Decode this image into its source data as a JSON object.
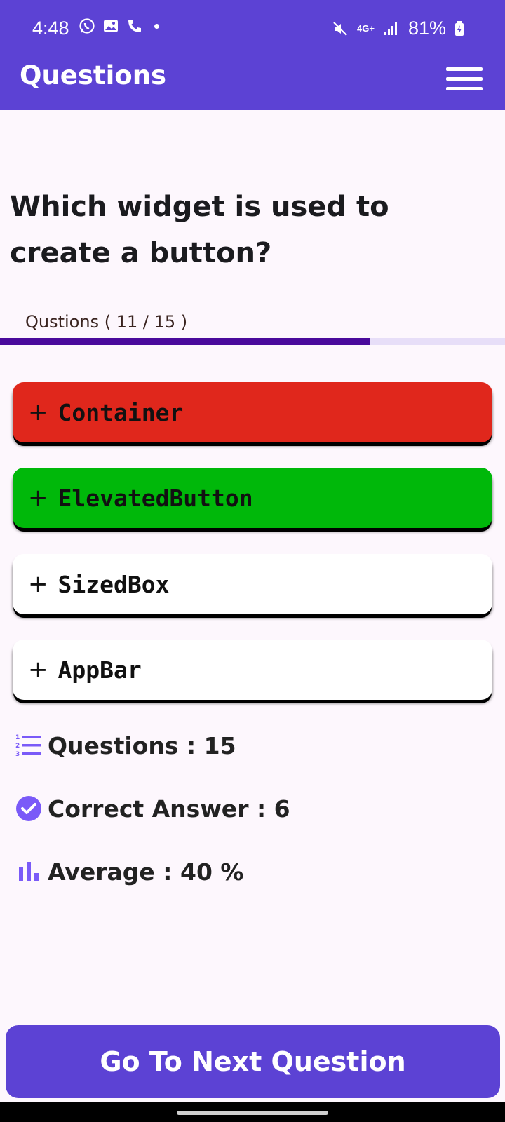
{
  "status_bar": {
    "time": "4:48",
    "network": "4G+",
    "battery": "81%",
    "icons": [
      "whatsapp-icon",
      "gallery-icon",
      "phone-icon",
      "mute-icon",
      "signal-icon",
      "battery-charging-icon"
    ]
  },
  "app_bar": {
    "title": "Questions",
    "menu_icon": "hamburger-menu-icon"
  },
  "question": {
    "text": "Which widget is used to create a button?"
  },
  "progress": {
    "label": "Qustions ( 11 / 15 )",
    "current": 11,
    "total": 15,
    "fill_color": "#4a0a9c",
    "track_color": "#e7def8"
  },
  "options": [
    {
      "prefix": "+",
      "label": "Container",
      "state": "wrong",
      "color": "#e0271c"
    },
    {
      "prefix": "+",
      "label": "ElevatedButton",
      "state": "correct",
      "color": "#00b80a"
    },
    {
      "prefix": "+",
      "label": "SizedBox",
      "state": "neutral",
      "color": "#ffffff"
    },
    {
      "prefix": "+",
      "label": "AppBar",
      "state": "neutral",
      "color": "#ffffff"
    }
  ],
  "stats": {
    "questions": {
      "label": "Questions : 15",
      "icon": "numbered-list-icon"
    },
    "correct": {
      "label": "Correct Answer : 6",
      "icon": "check-circle-icon"
    },
    "average": {
      "label": "Average : 40 %",
      "icon": "bar-chart-icon"
    }
  },
  "next_button": {
    "label": "Go To Next Question"
  },
  "colors": {
    "primary": "#5c42d4",
    "background": "#fdf7fd",
    "icon_accent": "#7a5af8"
  }
}
